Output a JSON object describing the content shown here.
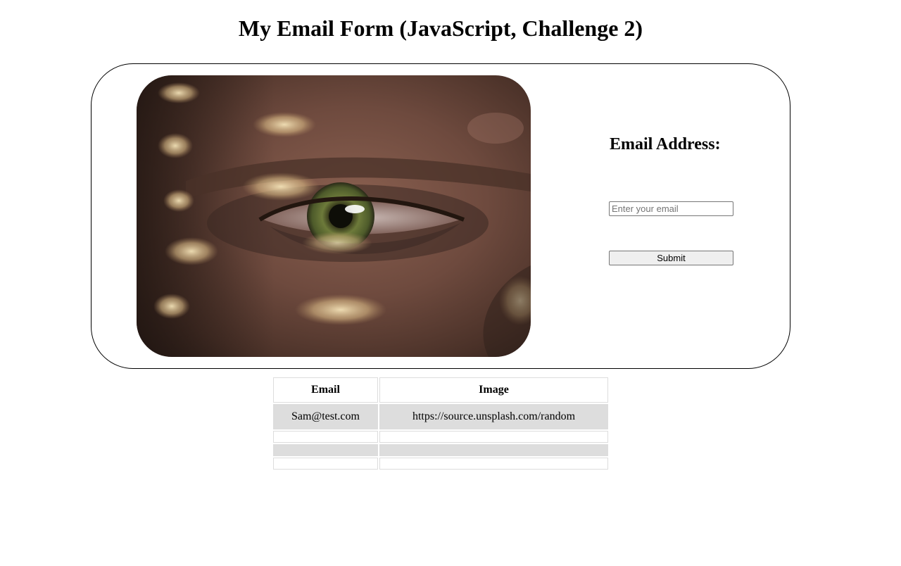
{
  "page": {
    "title": "My Email Form (JavaScript, Challenge 2)"
  },
  "form": {
    "label": "Email Address:",
    "input_placeholder": "Enter your email",
    "input_value": "",
    "submit_label": "Submit"
  },
  "photo": {
    "subject": "close-up of an eye with spots of light on skin"
  },
  "table": {
    "headers": [
      "Email",
      "Image"
    ],
    "rows": [
      {
        "email": "Sam@test.com",
        "image": "https://source.unsplash.com/random"
      },
      {
        "email": "",
        "image": ""
      },
      {
        "email": "",
        "image": ""
      },
      {
        "email": "",
        "image": ""
      }
    ]
  },
  "colors": {
    "row_shade": "#dddddd",
    "cell_border": "#dddddd",
    "card_border": "#000000"
  }
}
